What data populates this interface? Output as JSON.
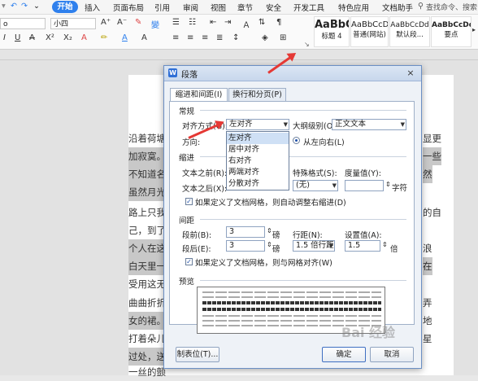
{
  "menubar": {
    "items": [
      "开始",
      "插入",
      "页面布局",
      "引用",
      "审阅",
      "视图",
      "章节",
      "安全",
      "开发工具",
      "特色应用",
      "文档助手"
    ],
    "search": "查找命令、搜索"
  },
  "ribbon": {
    "font_name": "o",
    "font_size": "小四",
    "styles": [
      {
        "sample": "AaBbC",
        "name": "标题 4"
      },
      {
        "sample": "AaBbCcD",
        "name": "普通(网站)"
      },
      {
        "sample": "AaBbCcDd",
        "name": "默认段..."
      },
      {
        "sample": "AaBbCcDd",
        "name": "要点"
      }
    ]
  },
  "document": {
    "left_lines": [
      "沿着荷塘",
      "加寂寞。",
      "不知道名",
      "虽然月光",
      "路上只我",
      "己，到了",
      "个人在这",
      "白天里一",
      "受用这无",
      "曲曲折折",
      "女的裙。",
      "打着朵儿",
      "过处，送",
      "一丝的颤"
    ],
    "right_lines": [
      "显更",
      "一些",
      "然",
      "的自",
      "浪",
      "在",
      "弄",
      "地",
      "星"
    ]
  },
  "dialog": {
    "title": "段落",
    "close": "×",
    "tabs": [
      "缩进和间距(I)",
      "换行和分页(P)"
    ],
    "general": {
      "section": "常规",
      "align_label": "对齐方式(G):",
      "align_value": "左对齐",
      "outline_label": "大纲级别(O):",
      "outline_value": "正文文本",
      "direction_label": "方向:",
      "direction_option": "从左向右(L)",
      "align_options": [
        "左对齐",
        "居中对齐",
        "右对齐",
        "两端对齐",
        "分散对齐"
      ]
    },
    "indent": {
      "section": "缩进",
      "before_label": "文本之前(R):",
      "after_label": "文本之后(X):",
      "special_label": "特殊格式(S):",
      "special_value": "(无)",
      "measure_label": "度量值(Y):",
      "measure_unit": "字符",
      "auto_adjust": "如果定义了文档网格，则自动调整右缩进(D)"
    },
    "spacing": {
      "section": "间距",
      "before_label": "段前(B):",
      "before_value": "3",
      "before_unit": "磅",
      "after_label": "段后(E):",
      "after_value": "3",
      "after_unit": "磅",
      "line_label": "行距(N):",
      "line_value": "1.5 倍行距",
      "set_label": "设置值(A):",
      "set_value": "1.5",
      "set_unit": "倍",
      "snap_grid": "如果定义了文档网格，则与网格对齐(W)"
    },
    "preview": {
      "section": "预览"
    },
    "buttons": {
      "tabs": "制表位(T)...",
      "ok": "确定",
      "cancel": "取消"
    }
  },
  "colors": {
    "accent": "#2f80ed",
    "arrow": "#e53935"
  }
}
